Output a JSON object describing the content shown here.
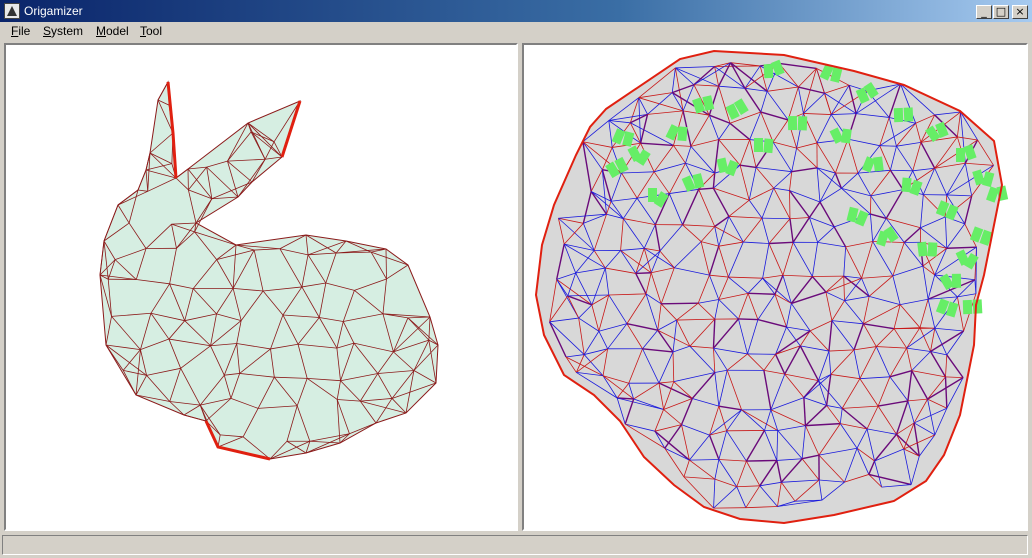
{
  "window": {
    "title": "Origamizer",
    "controls": {
      "minimize": "_",
      "maximize": "□",
      "close": "×"
    }
  },
  "menu": [
    {
      "label": "File",
      "mnemonic": "F",
      "rest": "ile"
    },
    {
      "label": "System",
      "mnemonic": "S",
      "rest": "ystem"
    },
    {
      "label": "Model",
      "mnemonic": "M",
      "rest": "odel"
    },
    {
      "label": "Tool",
      "mnemonic": "T",
      "rest": "ool"
    }
  ],
  "views": {
    "left": {
      "content": "3d-bunny-mesh"
    },
    "right": {
      "content": "crease-pattern"
    }
  },
  "colors": {
    "mesh_edge": "#8b1a1a",
    "boundary": "#e02010",
    "mesh_fill": "#d6eee2",
    "cp_fill": "#d8d8d8",
    "valley": "#1a1adc",
    "mountain": "#c81818",
    "tuck": "#6a0a7a",
    "flap": "#66ee66"
  },
  "statusbar": {
    "text": ""
  }
}
